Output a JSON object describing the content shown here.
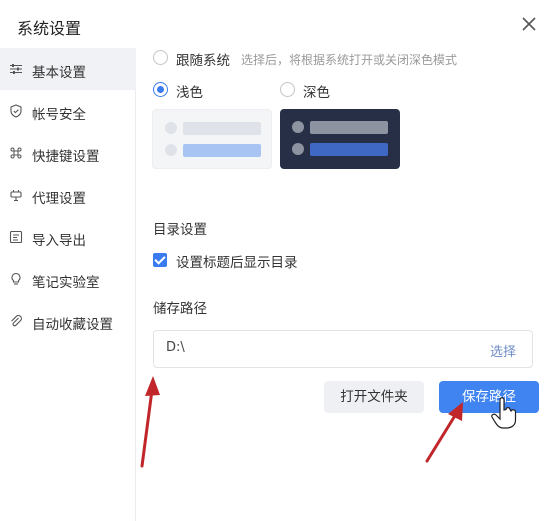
{
  "dialog": {
    "title": "系统设置"
  },
  "sidebar": {
    "items": [
      {
        "label": "基本设置",
        "icon": "sliders-icon",
        "active": true
      },
      {
        "label": "帐号安全",
        "icon": "shield-icon"
      },
      {
        "label": "快捷键设置",
        "icon": "command-key-icon"
      },
      {
        "label": "代理设置",
        "icon": "proxy-plug-icon"
      },
      {
        "label": "导入导出",
        "icon": "import-export-icon"
      },
      {
        "label": "笔记实验室",
        "icon": "lightbulb-icon"
      },
      {
        "label": "自动收藏设置",
        "icon": "paperclip-icon"
      }
    ]
  },
  "theme": {
    "follow_system_label": "跟随系统",
    "follow_system_hint": "选择后，将根据系统打开或关闭深色模式",
    "light_label": "浅色",
    "dark_label": "深色",
    "selected": "light"
  },
  "toc": {
    "section_title": "目录设置",
    "checkbox_label": "设置标题后显示目录",
    "checked": true
  },
  "storage": {
    "section_title": "储存路径",
    "path_value": "D:\\",
    "choose_label": "选择",
    "open_folder_button": "打开文件夹",
    "save_path_button": "保存路径"
  },
  "colors": {
    "accent": "#3f84f0",
    "dark_preview_bg": "#262f45",
    "annotation_arrow": "#c0262a"
  }
}
